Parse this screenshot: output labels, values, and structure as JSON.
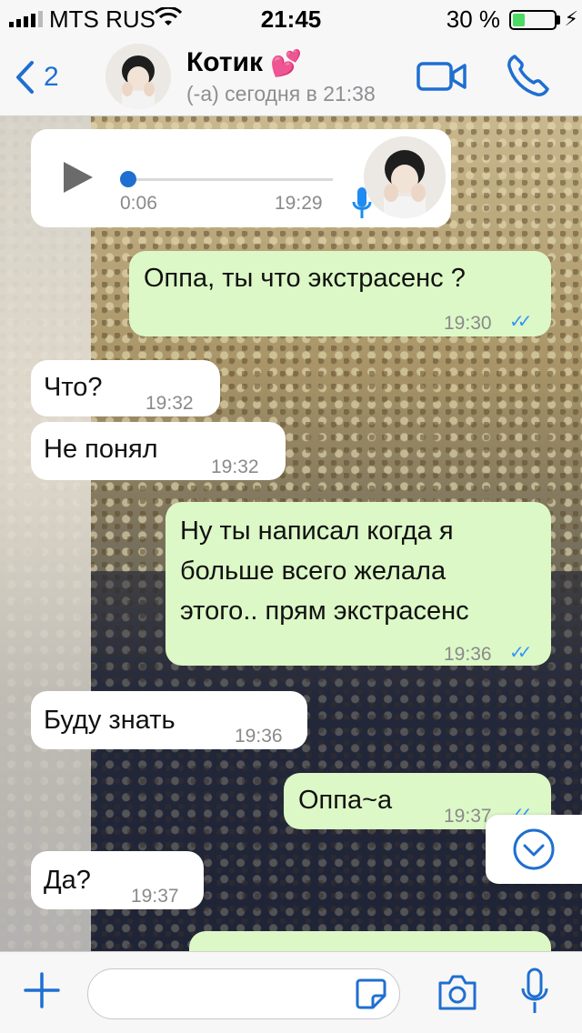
{
  "status_bar": {
    "carrier": "MTS RUS",
    "time": "21:45",
    "battery_percent": "30 %",
    "battery_level": 0.3
  },
  "header": {
    "back_count": "2",
    "contact_name": "Котик",
    "contact_status": "(-а) сегодня в 21:38"
  },
  "voice_message": {
    "duration": "0:06",
    "time": "19:29"
  },
  "messages": [
    {
      "direction": "out",
      "text": "Оппа, ты что экстрасенс ?",
      "time": "19:30"
    },
    {
      "direction": "in",
      "text": "Что?",
      "time": "19:32"
    },
    {
      "direction": "in",
      "text": "Не понял",
      "time": "19:32"
    },
    {
      "direction": "out",
      "text": "Ну ты написал когда я больше всего желала этого.. прям экстрасенс",
      "lines": [
        "Ну ты написал когда я",
        "больше всего желала",
        "этого.. прям экстрасенс"
      ],
      "time": "19:36"
    },
    {
      "direction": "in",
      "text": "Буду знать",
      "time": "19:36"
    },
    {
      "direction": "out",
      "text": "Оппа~а",
      "time": "19:37"
    },
    {
      "direction": "in",
      "text": "Да?",
      "time": "19:37"
    }
  ],
  "colors": {
    "accent": "#1f6fd1",
    "outgoing_bubble": "#dcf8c6",
    "incoming_bubble": "#ffffff",
    "read_ticks": "#3497f9"
  }
}
